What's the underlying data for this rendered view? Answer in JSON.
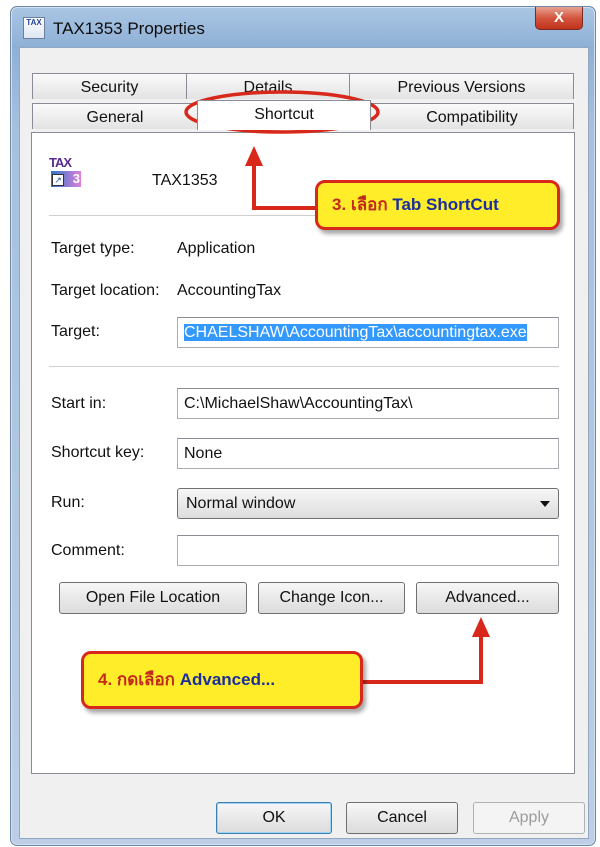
{
  "window": {
    "title": "TAX1353 Properties",
    "app_icon_text": "TAX",
    "close_glyph": "X"
  },
  "tabs": {
    "row1": [
      "Security",
      "Details",
      "Previous Versions"
    ],
    "row2": [
      "General",
      "Shortcut",
      "Compatibility"
    ],
    "active": "Shortcut"
  },
  "panel": {
    "icon": {
      "name": "tax-app-icon",
      "line1": "TAX",
      "line2": "3"
    },
    "shortcut_name": "TAX1353",
    "target_type_label": "Target type:",
    "target_type_value": "Application",
    "target_location_label": "Target location:",
    "target_location_value": "AccountingTax",
    "target_label": "Target:",
    "target_value": "CHAELSHAW\\AccountingTax\\accountingtax.exe",
    "start_in_label": "Start in:",
    "start_in_value": "C:\\MichaelShaw\\AccountingTax\\",
    "shortcut_key_label": "Shortcut key:",
    "shortcut_key_value": "None",
    "run_label": "Run:",
    "run_value": "Normal window",
    "comment_label": "Comment:",
    "comment_value": "",
    "buttons": {
      "open_file_location": "Open File Location",
      "change_icon": "Change Icon...",
      "advanced": "Advanced..."
    }
  },
  "footer": {
    "ok": "OK",
    "cancel": "Cancel",
    "apply": "Apply"
  },
  "annotations": {
    "step3_prefix": "3. เลือก ",
    "step3_highlight": "Tab ShortCut",
    "step4_prefix": "4. กดเลือก ",
    "step4_highlight": "Advanced..."
  },
  "colors": {
    "callout_fill": "#ffed2a",
    "callout_border": "#d8281b",
    "arrow": "#d8281b",
    "selection": "#3399ff"
  }
}
